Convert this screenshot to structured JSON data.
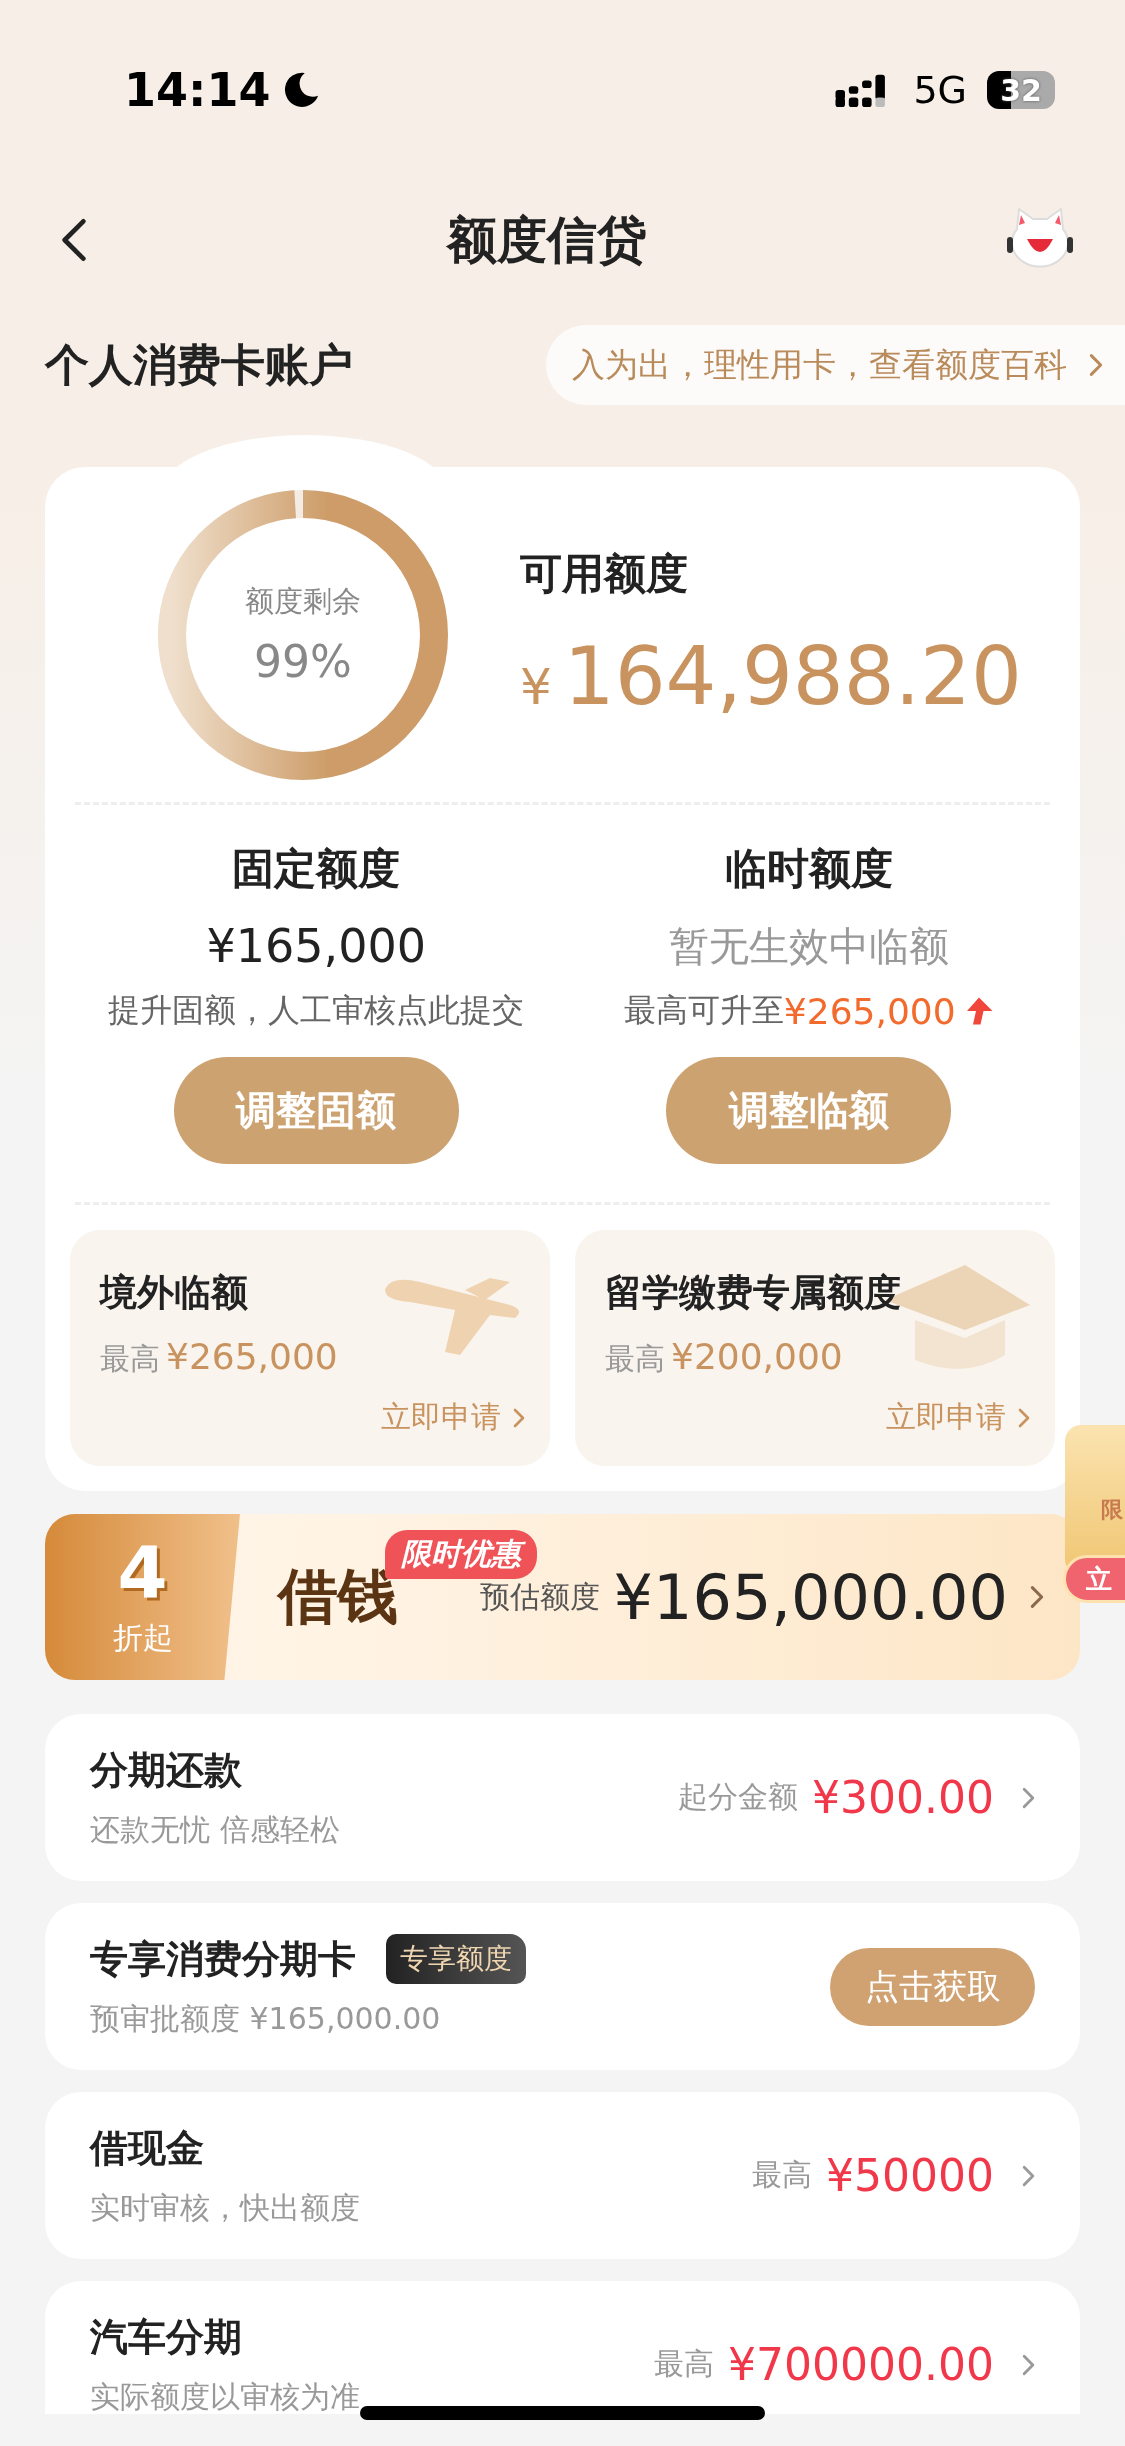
{
  "status_bar": {
    "time": "14:14",
    "network": "5G",
    "battery": "32"
  },
  "nav": {
    "title": "额度信贷"
  },
  "account": {
    "title": "个人消费卡账户",
    "tip": "入为出，理性用卡，查看额度百科"
  },
  "overview": {
    "ring_label": "额度剩余",
    "ring_percent": "99%",
    "level": 0.99,
    "available_label": "可用额度",
    "currency": "¥",
    "available_amount": "164,988.20"
  },
  "limits": [
    {
      "kind": "fixed",
      "title": "固定额度",
      "value": "¥165,000",
      "note": "提升固额，人工审核点此提交",
      "button": "调整固额"
    },
    {
      "kind": "temp",
      "title": "临时额度",
      "value": "暂无生效中临额",
      "note": "最高可升至",
      "note_amount": "¥265,000",
      "button": "调整临额"
    }
  ],
  "special": [
    {
      "kind": "plane",
      "title": "境外临额",
      "prefix": "最高",
      "amount": "¥265,000",
      "link": "立即申请"
    },
    {
      "kind": "cap",
      "title": "留学缴费专属额度",
      "prefix": "最高",
      "amount": "¥200,000",
      "link": "立即申请"
    }
  ],
  "loan_banner": {
    "discount": "4",
    "discount_unit": "折起",
    "title": "借钱",
    "badge": "限时优惠",
    "label": "预估额度",
    "amount": "¥165,000.00"
  },
  "products": [
    {
      "kind": "amount",
      "title": "分期还款",
      "subtitle": "还款无忧 倍感轻松",
      "label": "起分金额",
      "amount": "¥300.00"
    },
    {
      "kind": "button",
      "title": "专享消费分期卡",
      "tag": "专享额度",
      "subtitle": "预审批额度 ¥165,000.00",
      "button": "点击获取"
    },
    {
      "kind": "amount",
      "title": "借现金",
      "subtitle": "实时审核，快出额度",
      "label": "最高",
      "amount": "¥50000"
    },
    {
      "kind": "amount",
      "title": "汽车分期",
      "subtitle": "实际额度以审核为准",
      "label": "最高",
      "amount": "¥700000.00"
    }
  ],
  "floating_promo": {
    "tag": "限",
    "button": "立"
  }
}
